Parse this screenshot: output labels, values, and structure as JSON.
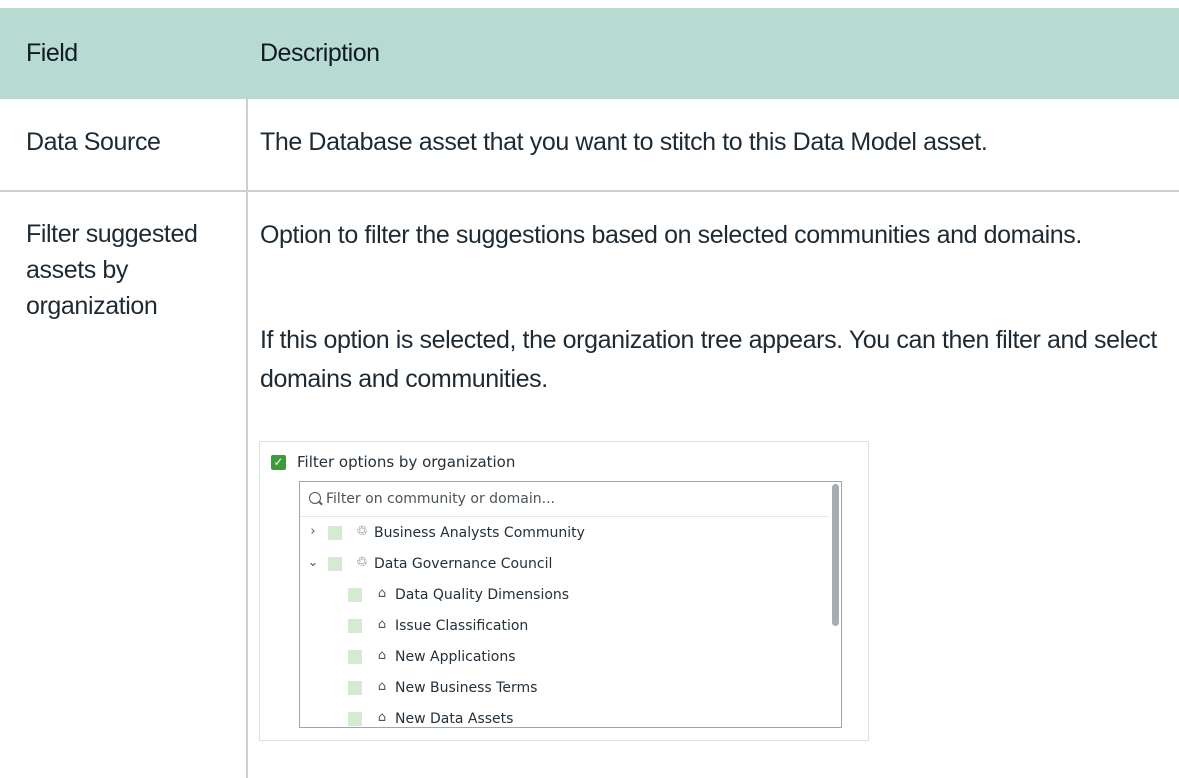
{
  "table": {
    "headers": {
      "field": "Field",
      "description": "Description"
    },
    "rows": [
      {
        "field": "Data Source",
        "description": "The Database asset that you want to stitch to this Data Model asset."
      },
      {
        "field": "Filter suggested assets by organization",
        "description_p1": "Option to filter the suggestions based on selected communities and domains.",
        "description_p2": "If this option is selected, the organization tree appears. You can then filter and select domains and communities."
      }
    ]
  },
  "widget": {
    "checkbox_label": "Filter options by organization",
    "checkbox_checked": true,
    "search_placeholder": "Filter on community or domain...",
    "tree": [
      {
        "label": "Business Analysts Community",
        "type": "community",
        "expanded": false
      },
      {
        "label": "Data Governance Council",
        "type": "community",
        "expanded": true
      },
      {
        "label": "Data Quality Dimensions",
        "type": "domain"
      },
      {
        "label": "Issue Classification",
        "type": "domain"
      },
      {
        "label": "New Applications",
        "type": "domain"
      },
      {
        "label": "New Business Terms",
        "type": "domain"
      },
      {
        "label": "New Data Assets",
        "type": "domain"
      }
    ],
    "colors": {
      "checkbox_checked": "#3f9a3c",
      "checkbox_unchecked": "#d4ebd2",
      "header_bg": "#b8dbd1"
    }
  }
}
